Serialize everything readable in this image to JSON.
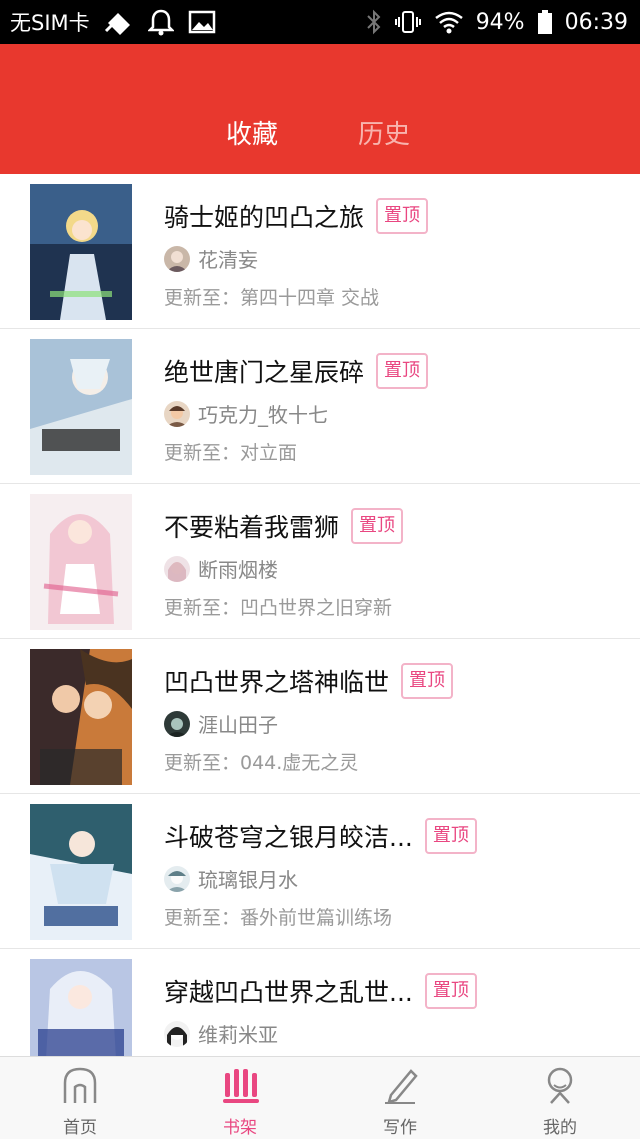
{
  "status_bar": {
    "carrier": "无SIM卡",
    "battery": "94%",
    "time": "06:39"
  },
  "header": {
    "tabs": [
      {
        "label": "收藏",
        "active": true
      },
      {
        "label": "历史",
        "active": false
      }
    ],
    "accent_color": "#e8382e"
  },
  "books": [
    {
      "title": "骑士姬的凹凸之旅",
      "pin_label": "置顶",
      "author": "花清妄",
      "update": "更新至：第四十四章   交战"
    },
    {
      "title": "绝世唐门之星辰碎",
      "pin_label": "置顶",
      "author": "巧克力_牧十七",
      "update": "更新至：对立面"
    },
    {
      "title": "不要粘着我雷狮",
      "pin_label": "置顶",
      "author": "断雨烟楼",
      "update": "更新至：凹凸世界之旧穿新"
    },
    {
      "title": "凹凸世界之塔神临世",
      "pin_label": "置顶",
      "author": "涯山田子",
      "update": "更新至：044.虚无之灵"
    },
    {
      "title": "斗破苍穹之银月皎洁...",
      "pin_label": "置顶",
      "author": "琉璃银月水",
      "update": "更新至：番外前世篇训练场"
    },
    {
      "title": "穿越凹凸世界之乱世...",
      "pin_label": "置顶",
      "author": "维莉米亚",
      "update": ""
    }
  ],
  "bottom_nav": [
    {
      "label": "首页",
      "icon": "home-icon"
    },
    {
      "label": "书架",
      "icon": "bookshelf-icon",
      "active": true
    },
    {
      "label": "写作",
      "icon": "pen-icon"
    },
    {
      "label": "我的",
      "icon": "profile-icon"
    }
  ],
  "pin_color": "#e94781"
}
